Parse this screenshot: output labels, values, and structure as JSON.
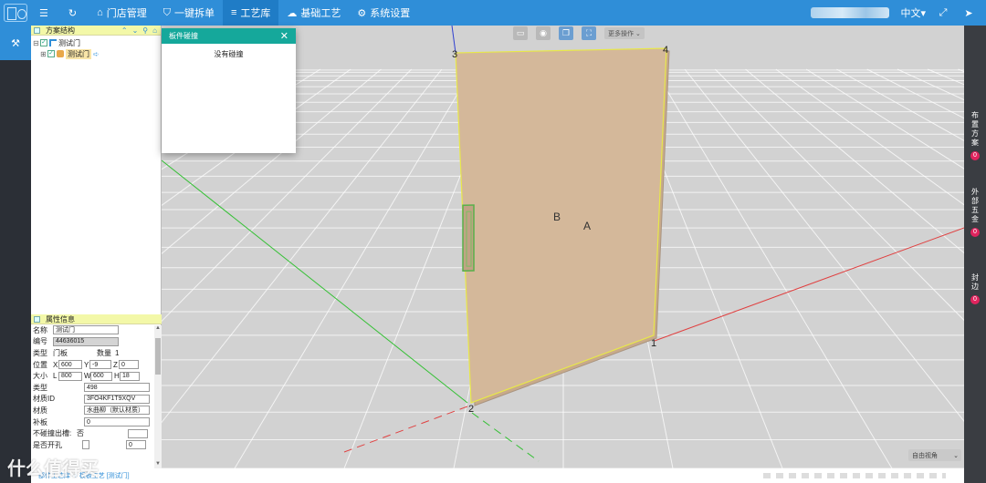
{
  "topbar": {
    "items": [
      {
        "icon": "☰",
        "label": ""
      },
      {
        "icon": "↻",
        "label": ""
      },
      {
        "icon": "⌂",
        "label": "门店管理"
      },
      {
        "icon": "⛉",
        "label": "一键拆单"
      },
      {
        "icon": "≡",
        "label": "工艺库"
      },
      {
        "icon": "☁",
        "label": "基础工艺"
      },
      {
        "icon": "⚙",
        "label": "系统设置"
      }
    ],
    "active_index": 4,
    "language": "中文▾",
    "expand_icon": "⤢",
    "send_icon": "➤"
  },
  "tree_panel": {
    "title": "方案结构",
    "tools": [
      "⌃",
      "⌄",
      "⚲",
      "⌂"
    ],
    "root": {
      "label": "测试门"
    },
    "child": {
      "label": "测试门"
    }
  },
  "props_panel": {
    "title": "属性信息",
    "name_label": "名称",
    "name_value": "测试门",
    "code_label": "编号",
    "code_value": "44636015",
    "type_label": "类型",
    "type_value": "门板",
    "qty_label": "数量",
    "qty_value": "1",
    "pos_label": "位置",
    "x_label": "X",
    "x_value": "600",
    "y_label": "Y",
    "y_value": "-9",
    "z_label": "Z",
    "z_value": "0",
    "size_label": "大小",
    "l_label": "L",
    "l_value": "800",
    "w_label": "W",
    "w_value": "600",
    "h_label": "H",
    "h_value": "18",
    "kind_label": "类型",
    "kind_value": "498",
    "matid_label": "材质ID",
    "matid_value": "3FO4KF1T9XQV",
    "mat_label": "材质",
    "mat_value": "水曲柳（默认材质）",
    "patch_label": "补板",
    "patch_value": "0",
    "collide_label": "不碰撞出槽:",
    "collide_value": "否",
    "open_label": "是否开孔",
    "open_value": "0"
  },
  "modal": {
    "title": "板件碰撞",
    "message": "没有碰撞",
    "close": "✕"
  },
  "viewport": {
    "more_ops": "更多操作 ⌄",
    "face_label_a": "A",
    "face_label_b": "B",
    "corners": [
      "1",
      "2",
      "3",
      "4"
    ],
    "view_select": "自由视角",
    "door_color": "#d4b89a",
    "edge_color": "#e8e84a",
    "grid_bg": "#d2d2d2"
  },
  "right_bar": {
    "items": [
      {
        "label": "布置方案",
        "count": "0"
      },
      {
        "label": "外部五金",
        "count": "0"
      },
      {
        "label": "封边",
        "count": "0"
      }
    ]
  },
  "status": {
    "breadcrumb": "部件工艺库 ➜ 板板工艺 [测试门]"
  },
  "watermark": "什么值得买"
}
